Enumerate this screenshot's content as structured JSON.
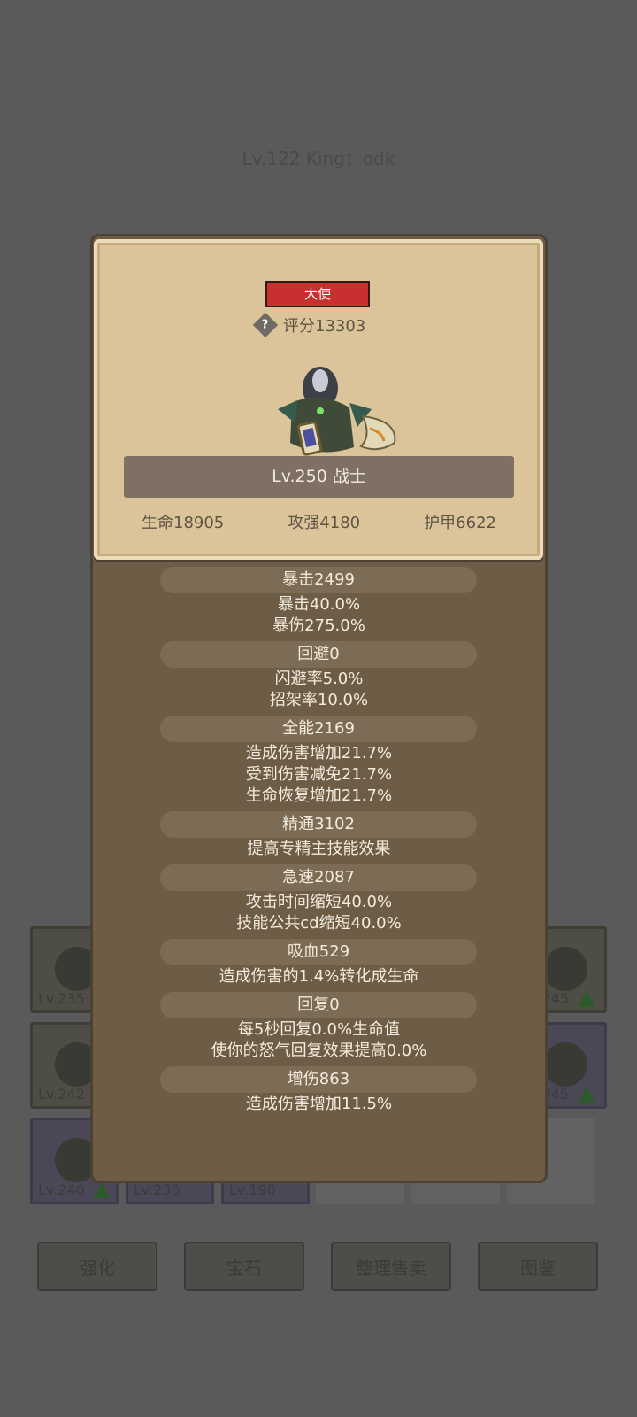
{
  "background": {
    "title": "Lv.122 King：odk",
    "slots": [
      {
        "level": "Lv.235",
        "upgrade": false
      },
      {
        "level": "245",
        "upgrade": true
      },
      {
        "level": "Lv.242",
        "upgrade": false
      },
      {
        "level": "245",
        "upgrade": true
      },
      {
        "level": "Lv.240",
        "upgrade": true
      },
      {
        "level": "Lv.235",
        "upgrade": false
      },
      {
        "level": "Lv.190",
        "upgrade": false
      }
    ],
    "buttons": [
      "强化",
      "宝石",
      "整理售卖",
      "图鉴"
    ]
  },
  "card": {
    "badge": "大使",
    "score": "评分13303",
    "class_label": "Lv.250 战士",
    "stats": [
      "生命18905",
      "攻强4180",
      "护甲6622"
    ]
  },
  "sections": [
    {
      "title": "暴击2499",
      "lines": [
        "暴击40.0%",
        "暴伤275.0%"
      ]
    },
    {
      "title": "回避0",
      "lines": [
        "闪避率5.0%",
        "招架率10.0%"
      ]
    },
    {
      "title": "全能2169",
      "lines": [
        "造成伤害增加21.7%",
        "受到伤害减免21.7%",
        "生命恢复增加21.7%"
      ]
    },
    {
      "title": "精通3102",
      "lines": [
        "提高专精主技能效果"
      ]
    },
    {
      "title": "急速2087",
      "lines": [
        "攻击时间缩短40.0%",
        "技能公共cd缩短40.0%"
      ]
    },
    {
      "title": "吸血529",
      "lines": [
        "造成伤害的1.4%转化成生命"
      ]
    },
    {
      "title": "回复0",
      "lines": [
        "每5秒回复0.0%生命值",
        "使你的怒气回复效果提高0.0%"
      ]
    },
    {
      "title": "增伤863",
      "lines": [
        "造成伤害增加11.5%"
      ]
    }
  ],
  "colors": {
    "badge_red": "#c7302e",
    "parchment": "#dcc49a",
    "panel_brown": "#6d5d47",
    "upgrade_green": "#2d5a2a"
  }
}
